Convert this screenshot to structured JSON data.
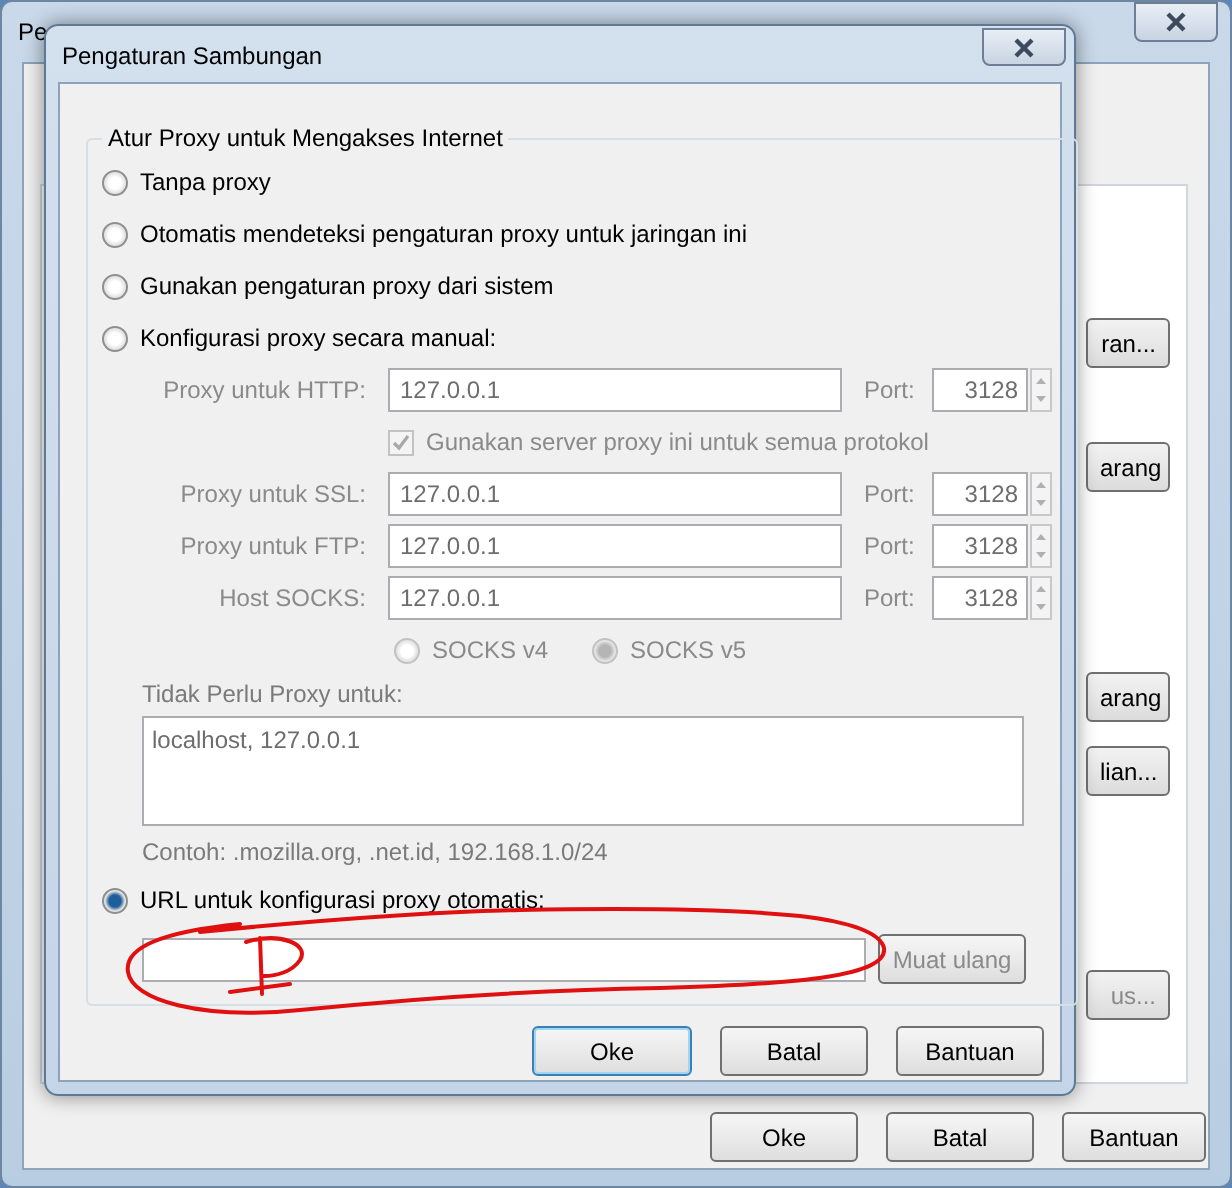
{
  "background_window": {
    "title": "Pe",
    "side_buttons": [
      "ran...",
      "arang",
      "arang",
      "lian...",
      "us..."
    ],
    "buttons": [
      "Oke",
      "Batal",
      "Bantuan"
    ]
  },
  "dialog": {
    "title": "Pengaturan Sambungan",
    "group_title": "Atur Proxy untuk Mengakses Internet",
    "options": [
      {
        "label": "Tanpa proxy",
        "selected": false
      },
      {
        "label": "Otomatis mendeteksi pengaturan proxy untuk jaringan ini",
        "selected": false
      },
      {
        "label": "Gunakan pengaturan proxy dari sistem",
        "selected": false
      },
      {
        "label": "Konfigurasi proxy secara manual:",
        "selected": false
      }
    ],
    "manual": {
      "disabled": true,
      "proxies": [
        {
          "label": "Proxy untuk HTTP:",
          "value": "127.0.0.1",
          "port_label": "Port:",
          "port": "3128"
        },
        {
          "label": "Proxy untuk SSL:",
          "value": "127.0.0.1",
          "port_label": "Port:",
          "port": "3128"
        },
        {
          "label": "Proxy untuk FTP:",
          "value": "127.0.0.1",
          "port_label": "Port:",
          "port": "3128"
        },
        {
          "label": "Host SOCKS:",
          "value": "127.0.0.1",
          "port_label": "Port:",
          "port": "3128"
        }
      ],
      "share_all": {
        "label": "Gunakan server proxy ini untuk semua protokol",
        "checked": true
      },
      "socks_versions": [
        {
          "label": "SOCKS v4",
          "selected": false
        },
        {
          "label": "SOCKS v5",
          "selected": true
        }
      ]
    },
    "no_proxy": {
      "label": "Tidak Perlu Proxy untuk:",
      "value": "localhost, 127.0.0.1",
      "example": "Contoh: .mozilla.org, .net.id, 192.168.1.0/24"
    },
    "auto_url": {
      "label": "URL untuk konfigurasi proxy otomatis:",
      "selected": true,
      "reload_button": "Muat ulang"
    },
    "buttons": [
      {
        "label": "Oke",
        "default": true
      },
      {
        "label": "Batal",
        "default": false
      },
      {
        "label": "Bantuan",
        "default": false
      }
    ]
  }
}
